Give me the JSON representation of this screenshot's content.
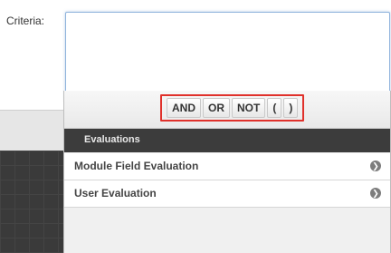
{
  "criteria": {
    "label": "Criteria:"
  },
  "operators": [
    "AND",
    "OR",
    "NOT",
    "(",
    ")"
  ],
  "evaluations": {
    "header": "Evaluations",
    "items": [
      {
        "label": "Module Field Evaluation",
        "icon": "chevron-right-circle-icon"
      },
      {
        "label": "User Evaluation",
        "icon": "chevron-right-circle-icon"
      }
    ]
  },
  "colors": {
    "highlight": "#e0312b",
    "header_bg": "#3c3c3c",
    "field_border": "#8fb3dc"
  }
}
